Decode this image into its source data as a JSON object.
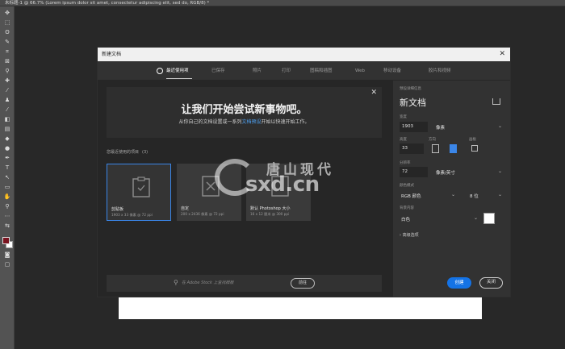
{
  "document_tab": "未标题-1 @ 66.7% (Lorem ipsum dolor sit amet, consectetur adipiscing elit, sed do, RGB/8) *",
  "toolbar": {
    "tools": [
      {
        "icon": "move-icon",
        "glyph": "✥"
      },
      {
        "icon": "marquee-icon",
        "glyph": "⬚"
      },
      {
        "icon": "lasso-icon",
        "glyph": "ʘ"
      },
      {
        "icon": "quick-select-icon",
        "glyph": "✎"
      },
      {
        "icon": "crop-icon",
        "glyph": "⌗"
      },
      {
        "icon": "frame-icon",
        "glyph": "⊠"
      },
      {
        "icon": "eyedropper-icon",
        "glyph": "⚲"
      },
      {
        "icon": "healing-icon",
        "glyph": "✚"
      },
      {
        "icon": "brush-icon",
        "glyph": "⁄"
      },
      {
        "icon": "stamp-icon",
        "glyph": "♟"
      },
      {
        "icon": "history-brush-icon",
        "glyph": "⁄"
      },
      {
        "icon": "eraser-icon",
        "glyph": "◧"
      },
      {
        "icon": "gradient-icon",
        "glyph": "▤"
      },
      {
        "icon": "blur-icon",
        "glyph": "◆"
      },
      {
        "icon": "dodge-icon",
        "glyph": "●"
      },
      {
        "icon": "pen-icon",
        "glyph": "✒"
      },
      {
        "icon": "type-icon",
        "glyph": "T"
      },
      {
        "icon": "path-select-icon",
        "glyph": "↖"
      },
      {
        "icon": "rectangle-icon",
        "glyph": "▭"
      },
      {
        "icon": "hand-icon",
        "glyph": "✋"
      },
      {
        "icon": "zoom-icon",
        "glyph": "⚲"
      },
      {
        "icon": "more-icon",
        "glyph": "⋯"
      },
      {
        "icon": "swap-colors-icon",
        "glyph": "⇆"
      }
    ],
    "bottom_tools": [
      {
        "icon": "quick-mask-icon",
        "glyph": "◙"
      },
      {
        "icon": "screen-mode-icon",
        "glyph": "▢"
      }
    ]
  },
  "dialog": {
    "title": "新建文档",
    "close_glyph": "✕",
    "tabs": [
      {
        "label": "最近使用项",
        "active": true
      },
      {
        "label": "已保存",
        "active": false
      },
      {
        "label": "照片",
        "active": false
      },
      {
        "label": "打印",
        "active": false
      },
      {
        "label": "图稿和插图",
        "active": false
      },
      {
        "label": "Web",
        "active": false
      },
      {
        "label": "移动设备",
        "active": false
      },
      {
        "label": "胶片和视频",
        "active": false
      }
    ],
    "banner": {
      "close_glyph": "✕",
      "headline": "让我们开始尝试新事物吧。",
      "sub_before": "从你自己的文档设置或一系列",
      "sub_link": "文档预设",
      "sub_after": "开始以快速开始工作。"
    },
    "recent": {
      "label": "您最近使用的项目",
      "count": "(3)",
      "items": [
        {
          "name": "剪贴板",
          "meta": "1903 x 33 像素 @ 72 ppi",
          "selected": true
        },
        {
          "name": "自定",
          "meta": "200 x 2436 像素 @ 72 ppi",
          "selected": false
        },
        {
          "name": "默认 Photoshop 大小",
          "meta": "16 x 12 厘米 @ 300 ppi",
          "selected": false
        }
      ]
    },
    "search": {
      "placeholder": "在 Adobe Stock 上查找模板",
      "go_label": "前往"
    },
    "details": {
      "section_label": "预设详细信息",
      "doc_name": "新文档",
      "width_label": "宽度",
      "width_value": "1903",
      "width_unit": "像素",
      "height_label": "高度",
      "height_value": "33",
      "orientation_label": "方向",
      "artboard_label": "画板",
      "resolution_label": "分辨率",
      "resolution_value": "72",
      "resolution_unit": "像素/英寸",
      "color_mode_label": "颜色模式",
      "color_mode_value": "RGB 颜色",
      "bit_depth_value": "8 位",
      "background_label": "背景内容",
      "background_value": "白色",
      "background_color": "#ffffff",
      "advanced_label": "高级选项"
    },
    "create_label": "创建",
    "close_label": "关闭"
  },
  "watermark": {
    "cn": "唐山现代",
    "en": "sxd.cn"
  },
  "colors": {
    "accent": "#1473e6",
    "selected_border": "#3b86e8",
    "link": "#4fa3f5",
    "foreground_swatch": "#7a1420"
  }
}
